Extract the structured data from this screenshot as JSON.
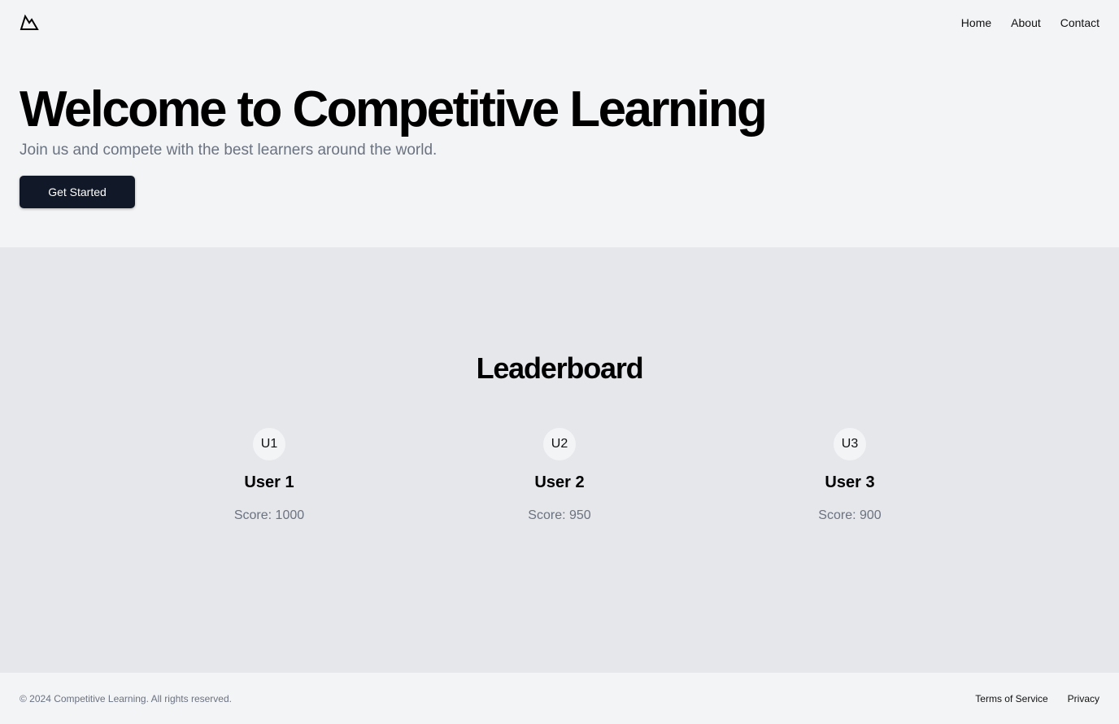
{
  "header": {
    "logo_icon": "mountain-icon",
    "nav": [
      "Home",
      "About",
      "Contact"
    ]
  },
  "hero": {
    "title": "Welcome to Competitive Learning",
    "subtitle": "Join us and compete with the best learners around the world.",
    "cta_label": "Get Started"
  },
  "leaderboard": {
    "title": "Leaderboard",
    "users": [
      {
        "initials": "U1",
        "name": "User 1",
        "score": "Score: 1000"
      },
      {
        "initials": "U2",
        "name": "User 2",
        "score": "Score: 950"
      },
      {
        "initials": "U3",
        "name": "User 3",
        "score": "Score: 900"
      }
    ]
  },
  "footer": {
    "copyright": "© 2024 Competitive Learning. All rights reserved.",
    "links": [
      "Terms of Service",
      "Privacy"
    ]
  },
  "colors": {
    "page_bg": "#f3f4f6",
    "section_bg": "#e5e7eb",
    "button_bg": "#111827",
    "muted_text": "#6b7280"
  }
}
